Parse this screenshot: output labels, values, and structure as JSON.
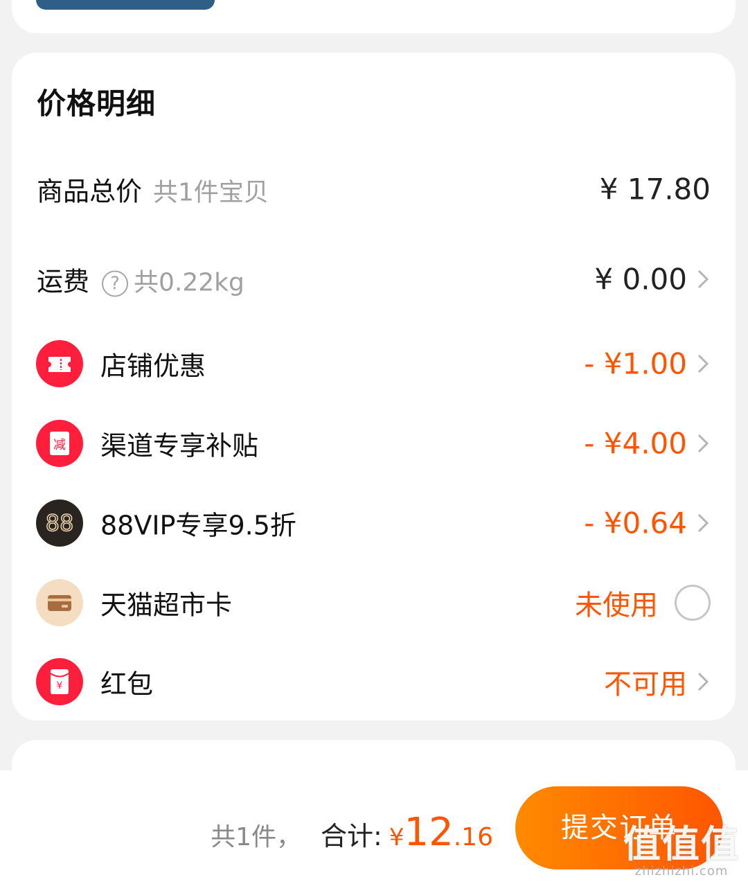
{
  "price_detail": {
    "title": "价格明细",
    "rows": {
      "goods_total": {
        "label": "商品总价",
        "sub": "共1件宝贝",
        "amount": "¥ 17.80"
      },
      "shipping": {
        "label": "运费",
        "help_icon": "question-circle-icon",
        "sub": "共0.22kg",
        "amount": "¥ 0.00"
      },
      "shop_discount": {
        "label": "店铺优惠",
        "amount": "- ¥1.00",
        "icon": "ticket-icon",
        "icon_color": "#ff1f3c"
      },
      "channel_subsidy": {
        "label": "渠道专享补贴",
        "amount": "- ¥4.00",
        "icon": "reduce-icon",
        "icon_text": "减",
        "icon_color": "#ff1f3c"
      },
      "vip_discount": {
        "label": "88VIP专享9.5折",
        "amount": "- ¥0.64",
        "icon": "vip88-icon",
        "icon_text": "88",
        "icon_color": "#2a2421"
      },
      "supermarket_card": {
        "label": "天猫超市卡",
        "status": "未使用",
        "icon": "card-icon",
        "icon_color": "#f4ddc0"
      },
      "red_packet": {
        "label": "红包",
        "status": "不可用",
        "icon": "red-packet-icon",
        "icon_text": "¥",
        "icon_color": "#ff1f3c"
      }
    }
  },
  "bottom_bar": {
    "count_text": "共1件，",
    "total_label": "合计:",
    "currency": "¥",
    "total_int": "12",
    "total_dec": ".16",
    "submit_label": "提交订单"
  },
  "watermark": {
    "brand": "值值值",
    "domain": "zhizhizhi.com"
  },
  "colors": {
    "accent_orange": "#ff5500",
    "background": "#f2f2f2",
    "muted_text": "#a0a0a0"
  }
}
